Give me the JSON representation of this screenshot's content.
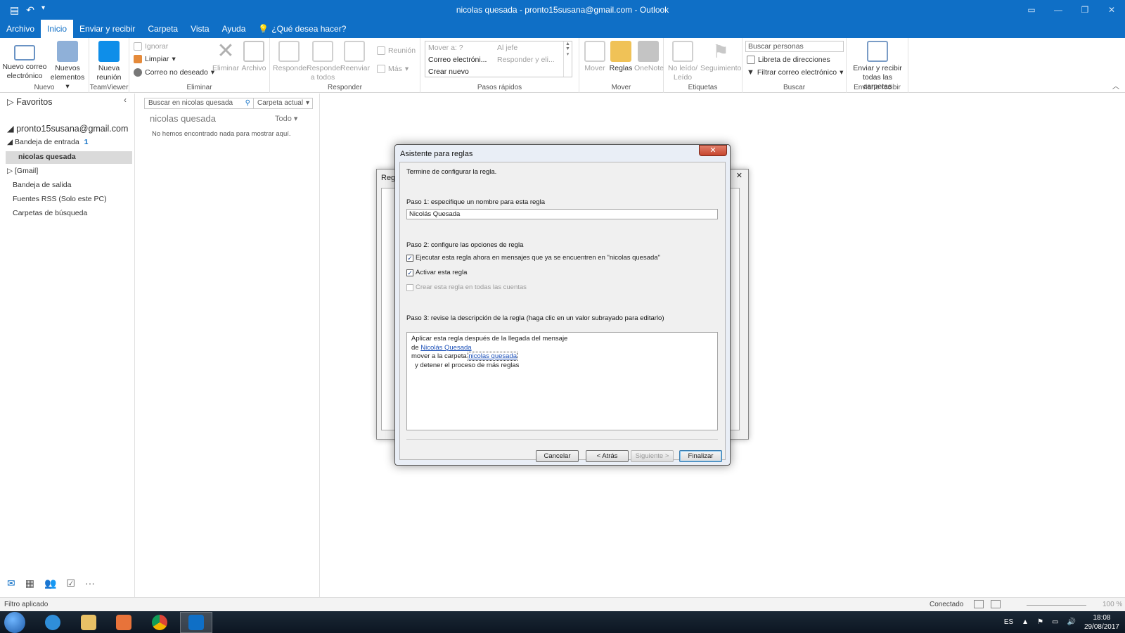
{
  "window": {
    "title": "nicolas quesada - pronto15susana@gmail.com  -  Outlook"
  },
  "menu": {
    "tabs": [
      "Archivo",
      "Inicio",
      "Enviar y recibir",
      "Carpeta",
      "Vista",
      "Ayuda"
    ],
    "tell_me": "¿Qué desea hacer?"
  },
  "ribbon": {
    "nuevo": {
      "new_mail_line1": "Nuevo correo",
      "new_mail_line2": "electrónico",
      "new_items_line1": "Nuevos",
      "new_items_line2": "elementos",
      "label": "Nuevo"
    },
    "teamviewer": {
      "meeting_line1": "Nueva",
      "meeting_line2": "reunión",
      "label": "TeamViewer"
    },
    "eliminar": {
      "ignore": "Ignorar",
      "clean": "Limpiar",
      "junk": "Correo no deseado",
      "delete": "Eliminar",
      "archive": "Archivo",
      "label": "Eliminar"
    },
    "responder": {
      "reply": "Responder",
      "reply_all_line1": "Responder",
      "reply_all_line2": "a todos",
      "forward": "Reenviar",
      "meeting": "Reunión",
      "more": "Más",
      "label": "Responder"
    },
    "pasos": {
      "move_to": "Mover a: ?",
      "to_boss": "Al jefe",
      "email": "Correo electróni...",
      "reply_delete": "Responder y eli...",
      "create": "Crear nuevo",
      "label": "Pasos rápidos"
    },
    "mover": {
      "move": "Mover",
      "rules": "Reglas",
      "onenote": "OneNote",
      "label": "Mover"
    },
    "etiquetas": {
      "unread_line1": "No leído/",
      "unread_line2": "Leído",
      "followup": "Seguimiento",
      "label": "Etiquetas"
    },
    "buscar": {
      "search_people": "Buscar personas",
      "address_book": "Libreta de direcciones",
      "filter": "Filtrar correo electrónico",
      "label": "Buscar"
    },
    "enviar": {
      "send_all_line1": "Enviar y recibir",
      "send_all_line2": "todas las carpetas",
      "label": "Enviar o recibir"
    }
  },
  "nav": {
    "favorites": "Favoritos",
    "account": "pronto15susana@gmail.com",
    "inbox": "Bandeja de entrada",
    "inbox_count": "1",
    "selected_folder": "nicolas quesada",
    "gmail": "[Gmail]",
    "outbox": "Bandeja de salida",
    "rss": "Fuentes RSS (Solo este PC)",
    "search_folders": "Carpetas de búsqueda"
  },
  "messages": {
    "search_placeholder": "Buscar en nicolas quesada",
    "scope": "Carpeta actual",
    "folder": "nicolas quesada",
    "filter": "Todo",
    "empty": "No hemos encontrado nada para mostrar aquí."
  },
  "back_dialog": {
    "title": "Regl"
  },
  "wizard": {
    "title": "Asistente para reglas",
    "intro": "Termine de configurar la regla.",
    "step1": "Paso 1: especifique un nombre para esta regla",
    "rule_name": "Nicolás Quesada",
    "step2": "Paso 2: configure las opciones de regla",
    "opt_run_now": "Ejecutar esta regla ahora en mensajes que ya se encuentren en \"nicolas quesada\"",
    "opt_activate": "Activar esta regla",
    "opt_all_accounts": "Crear esta regla en todas las cuentas",
    "step3": "Paso 3: revise la descripción de la regla (haga clic en un valor subrayado para editarlo)",
    "desc_line1": "Aplicar esta regla después de la llegada del mensaje",
    "desc_from_prefix": "de ",
    "desc_from_link": "Nicolás Quesada",
    "desc_move_prefix": "mover a la carpeta ",
    "desc_move_link": "nicolas quesada",
    "desc_stop": "y detener el proceso de más reglas",
    "btn_cancel": "Cancelar",
    "btn_back": "< Atrás",
    "btn_next": "Siguiente >",
    "btn_finish": "Finalizar"
  },
  "status": {
    "left": "Filtro aplicado",
    "connection": "Conectado",
    "zoom": "100 %"
  },
  "taskbar": {
    "lang": "ES",
    "time": "18:08",
    "date": "29/08/2017"
  },
  "colors": {
    "accent": "#0f6fc6"
  }
}
